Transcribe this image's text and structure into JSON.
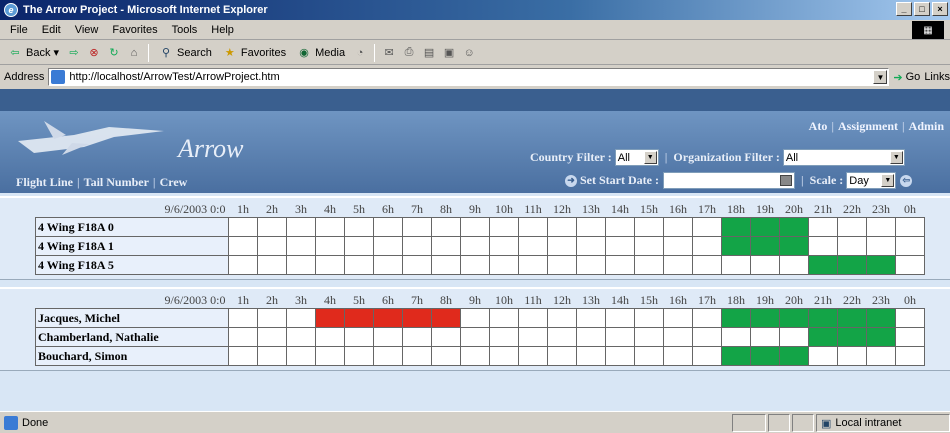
{
  "window": {
    "title": "The Arrow Project - Microsoft Internet Explorer",
    "controls": {
      "minimize": "_",
      "maximize": "□",
      "close": "×"
    }
  },
  "menubar": [
    "File",
    "Edit",
    "View",
    "Favorites",
    "Tools",
    "Help"
  ],
  "toolbar": {
    "back": "Back",
    "search": "Search",
    "favorites": "Favorites",
    "media": "Media"
  },
  "address": {
    "label": "Address",
    "url": "http://localhost/ArrowTest/ArrowProject.htm",
    "go": "Go",
    "links": "Links"
  },
  "page": {
    "brand": "Arrow",
    "top_links": [
      "Ato",
      "Assignment",
      "Admin"
    ],
    "nav_links": [
      "Flight Line",
      "Tail Number",
      "Crew"
    ],
    "country_filter": {
      "label": "Country Filter :",
      "value": "All"
    },
    "org_filter": {
      "label": "Organization Filter :",
      "value": "All"
    },
    "start_date": {
      "label": "Set Start Date :",
      "value": ""
    },
    "scale": {
      "label": "Scale :",
      "value": "Day"
    }
  },
  "hours": [
    "1h",
    "2h",
    "3h",
    "4h",
    "5h",
    "6h",
    "7h",
    "8h",
    "9h",
    "10h",
    "11h",
    "12h",
    "13h",
    "14h",
    "15h",
    "16h",
    "17h",
    "18h",
    "19h",
    "20h",
    "21h",
    "22h",
    "23h",
    "0h"
  ],
  "grid_aircraft": {
    "date": "9/6/2003 0:0",
    "rows": [
      {
        "label": "4 Wing F18A 0",
        "blocks": [
          {
            "start": 18,
            "end": 20,
            "color": "#13a447"
          }
        ]
      },
      {
        "label": "4 Wing F18A 1",
        "blocks": [
          {
            "start": 18,
            "end": 20,
            "color": "#13a447"
          }
        ]
      },
      {
        "label": "4 Wing F18A 5",
        "blocks": [
          {
            "start": 21,
            "end": 23,
            "color": "#13a447"
          }
        ]
      }
    ]
  },
  "grid_crew": {
    "date": "9/6/2003 0:0",
    "rows": [
      {
        "label": "Jacques, Michel",
        "blocks": [
          {
            "start": 4,
            "end": 8,
            "color": "#e02a1c"
          },
          {
            "start": 18,
            "end": 23,
            "color": "#13a447"
          }
        ]
      },
      {
        "label": "Chamberland, Nathalie",
        "blocks": [
          {
            "start": 21,
            "end": 23,
            "color": "#13a447"
          }
        ]
      },
      {
        "label": "Bouchard, Simon",
        "blocks": [
          {
            "start": 18,
            "end": 20,
            "color": "#13a447"
          }
        ]
      }
    ]
  },
  "status": {
    "text": "Done",
    "zone": "Local intranet"
  }
}
